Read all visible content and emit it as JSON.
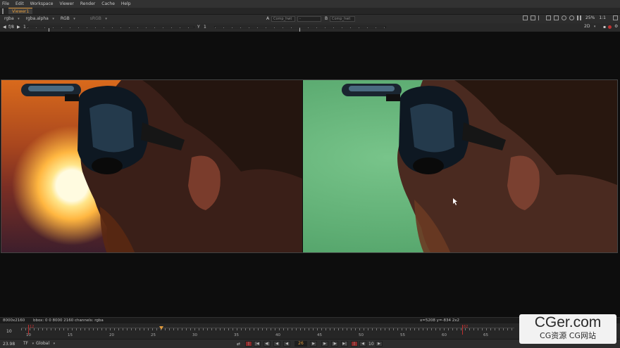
{
  "menu": [
    "File",
    "Edit",
    "Workspace",
    "Viewer",
    "Render",
    "Cache",
    "Help"
  ],
  "tab": {
    "label": "Viewer1"
  },
  "toolbar1": {
    "channels": "rgba",
    "channels_alpha": "rgba.alpha",
    "colorspace": "RGB",
    "display": "sRGB",
    "input_a_label": "A",
    "input_a_value": "Comp_hwt",
    "input_a_op": "-",
    "input_b_label": "B",
    "input_b_value": "Comp_hwt",
    "zoom": "25%",
    "proxy": "1:1"
  },
  "toolbar2": {
    "frame_step": "f/8",
    "gain_value": "1",
    "gamma_label": "Y",
    "gamma_value": "1",
    "view_mode": "2D"
  },
  "status": {
    "format": "8000x2160",
    "bbox": "bbox: 0 0 8000 2160 channels: rgba",
    "coords": "x=5208 y=-834 2x2"
  },
  "timeline": {
    "start": "10",
    "ticks": [
      "10",
      "15",
      "20",
      "25",
      "30",
      "35",
      "40",
      "45",
      "50",
      "55",
      "60",
      "65"
    ],
    "in_point": "12",
    "out_point": "62"
  },
  "transport": {
    "fps": "23.98",
    "tf_label": "TF",
    "mode": "Global",
    "current_frame": "26",
    "increment": "10"
  },
  "watermark": {
    "main": "CGer.com",
    "sub": "CG资源 CG网站"
  },
  "colors": {
    "accent": "#e09a3c",
    "marker": "#c03030"
  }
}
